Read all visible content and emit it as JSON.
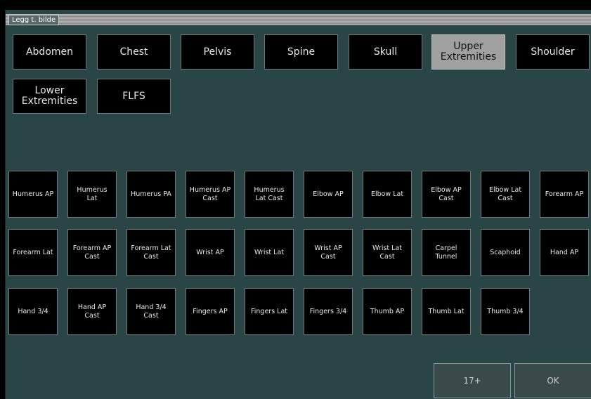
{
  "window": {
    "title": "Legg t. bilde"
  },
  "categories": [
    {
      "label": "Abdomen",
      "selected": false
    },
    {
      "label": "Chest",
      "selected": false
    },
    {
      "label": "Pelvis",
      "selected": false
    },
    {
      "label": "Spine",
      "selected": false
    },
    {
      "label": "Skull",
      "selected": false
    },
    {
      "label": "Upper\nExtremities",
      "selected": true
    },
    {
      "label": "Shoulder",
      "selected": false
    },
    {
      "label": "Lower\nExtremities",
      "selected": false
    },
    {
      "label": "FLFS",
      "selected": false
    }
  ],
  "views": [
    "Humerus AP",
    "Humerus\nLat",
    "Humerus PA",
    "Humerus AP\nCast",
    "Humerus\nLat Cast",
    "Elbow AP",
    "Elbow Lat",
    "Elbow AP\nCast",
    "Elbow Lat\nCast",
    "Forearm AP",
    "Forearm Lat",
    "Forearm AP\nCast",
    "Forearm Lat\nCast",
    "Wrist AP",
    "Wrist Lat",
    "Wrist AP\nCast",
    "Wrist Lat\nCast",
    "Carpel\nTunnel",
    "Scaphoid",
    "Hand AP",
    "Hand 3/4",
    "Hand AP\nCast",
    "Hand 3/4\nCast",
    "Fingers AP",
    "Fingers Lat",
    "Fingers 3/4",
    "Thumb AP",
    "Thumb Lat",
    "Thumb 3/4"
  ],
  "footer": {
    "more_label": "17+",
    "ok_label": "OK"
  }
}
